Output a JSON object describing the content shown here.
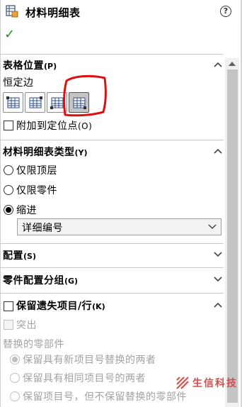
{
  "header": {
    "title": "材料明细表",
    "help_symbol": "?",
    "ok_symbol": "✓"
  },
  "table_position": {
    "title": "表格位置",
    "key": "(P)",
    "anchor_label": "恒定边",
    "buttons": [
      "top-left-anchor",
      "top-right-anchor",
      "bottom-left-anchor",
      "bottom-right-anchor"
    ],
    "selected_button": 3,
    "attach_label": "附加到定位点",
    "attach_key": "(O)",
    "attach_checked": false
  },
  "bom_type": {
    "title": "材料明细表类型",
    "key": "(Y)",
    "options": [
      "仅限顶层",
      "仅限零件",
      "缩进"
    ],
    "selected": "缩进",
    "indent_select_value": "详细编号"
  },
  "configurations": {
    "title": "配置",
    "key": "(S)"
  },
  "part_config_grouping": {
    "title": "零件配置分组",
    "key": "(G)"
  },
  "keep_missing": {
    "title": "保留遗失项目/行",
    "key": "(K)",
    "checked": false,
    "strikeout_label": "突出",
    "replaced_parts_label": "替换的零部件",
    "options": [
      "保留具有新项目号替换的两者",
      "保留具有相同项目号的两者",
      "保留项目号，但不保留替换的零部件"
    ],
    "selected_index": 0
  },
  "watermark": {
    "text": "生信科技"
  },
  "colors": {
    "check_green": "#2e8b2e",
    "highlight_red": "#e01010",
    "watermark_red": "#d44b4b"
  }
}
